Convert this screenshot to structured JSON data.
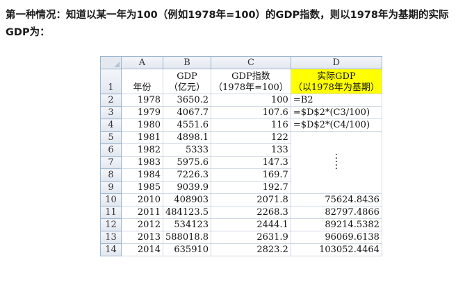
{
  "heading": "第一种情况：知道以某一年为100（例如1978年=100）的GDP指数，则以1978年为基期的实际GDP为：",
  "columns": [
    "A",
    "B",
    "C",
    "D"
  ],
  "header_row": {
    "row": "1",
    "a": "年份",
    "b1": "GDP",
    "b2": "（亿元）",
    "c1": "GDP指数",
    "c2": "（1978年=100）",
    "d1": "实际GDP",
    "d2": "（以1978年为基期）"
  },
  "rows": [
    {
      "row": "2",
      "a": "1978",
      "b": "3650.2",
      "c": "100",
      "d": "=B2"
    },
    {
      "row": "3",
      "a": "1979",
      "b": "4067.7",
      "c": "107.6",
      "d": "=$D$2*(C3/100)"
    },
    {
      "row": "4",
      "a": "1980",
      "b": "4551.6",
      "c": "116",
      "d": "=$D$2*(C4/100)"
    },
    {
      "row": "5",
      "a": "1981",
      "b": "4898.1",
      "c": "122",
      "d": ""
    },
    {
      "row": "6",
      "a": "1982",
      "b": "5333",
      "c": "133",
      "d": ""
    },
    {
      "row": "7",
      "a": "1983",
      "b": "5975.6",
      "c": "147.3",
      "d": ""
    },
    {
      "row": "8",
      "a": "1984",
      "b": "7226.3",
      "c": "169.7",
      "d": ""
    },
    {
      "row": "9",
      "a": "1985",
      "b": "9039.9",
      "c": "192.7",
      "d": ""
    },
    {
      "row": "10",
      "a": "2010",
      "b": "408903",
      "c": "2071.8",
      "d": "75624.8436"
    },
    {
      "row": "11",
      "a": "2011",
      "b": "484123.5",
      "c": "2268.3",
      "d": "82797.4866"
    },
    {
      "row": "12",
      "a": "2012",
      "b": "534123",
      "c": "2444.1",
      "d": "89214.5382"
    },
    {
      "row": "13",
      "a": "2013",
      "b": "588018.8",
      "c": "2631.9",
      "d": "96069.6138"
    },
    {
      "row": "14",
      "a": "2014",
      "b": "635910",
      "c": "2823.2",
      "d": "103052.4464"
    }
  ],
  "colors": {
    "highlight": "#ffff00",
    "gridline": "#d0d7e5"
  }
}
